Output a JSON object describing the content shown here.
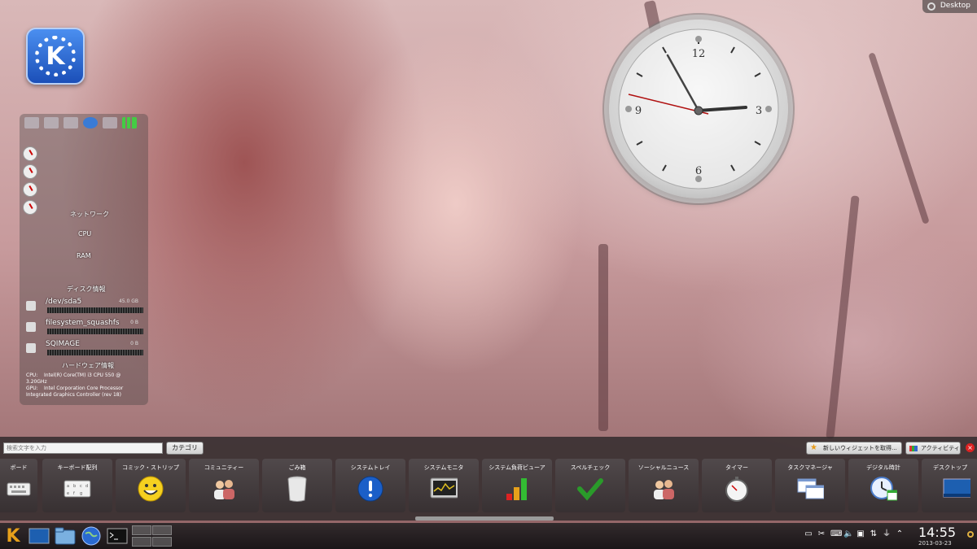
{
  "desktop": {
    "label": "Desktop"
  },
  "system_monitor": {
    "network_label": "ネットワーク",
    "cpu_label": "CPU",
    "ram_label": "RAM",
    "disk_header": "ディスク情報",
    "disks": [
      {
        "name": "/dev/sda5",
        "value": "45.0 GB"
      },
      {
        "name": "filesystem_squashfs",
        "value": "0 B"
      },
      {
        "name": "SQIMAGE",
        "value": "0 B"
      }
    ],
    "hardware_header": "ハードウェア情報",
    "cpu_key": "CPU:",
    "cpu_value": "Intel(R) Core(TM) i3 CPU 550 @ 3.20GHz",
    "gpu_key": "GPU:",
    "gpu_value": "Intel Corporation Core Processor Integrated Graphics Controller (rev 18)"
  },
  "clock_widget": {
    "numerals": [
      "12",
      "3",
      "6",
      "9"
    ]
  },
  "widget_explorer": {
    "search_placeholder": "検索文字を入力",
    "category_label": "カテゴリ",
    "get_widgets_label": "新しいウィジェットを取得...",
    "activities_label": "アクティビティ",
    "widgets": [
      {
        "name": "ボード",
        "icon": "keyboard-icon"
      },
      {
        "name": "キーボード配列",
        "icon": "keyboard-layout-icon"
      },
      {
        "name": "コミック・ストリップ",
        "icon": "smiley-icon"
      },
      {
        "name": "コミュニティー",
        "icon": "community-icon"
      },
      {
        "name": "ごみ箱",
        "icon": "trash-icon"
      },
      {
        "name": "システムトレイ",
        "icon": "info-icon"
      },
      {
        "name": "システムモニタ",
        "icon": "monitor-icon"
      },
      {
        "name": "システム負荷ビューア",
        "icon": "load-bars-icon"
      },
      {
        "name": "スペルチェック",
        "icon": "check-icon"
      },
      {
        "name": "ソーシャルニュース",
        "icon": "social-icon"
      },
      {
        "name": "タイマー",
        "icon": "stopwatch-icon"
      },
      {
        "name": "タスクマネージャ",
        "icon": "windows-icon"
      },
      {
        "name": "デジタル時計",
        "icon": "digital-clock-icon"
      },
      {
        "name": "デスクトップ",
        "icon": "desktop-icon"
      }
    ]
  },
  "taskbar": {
    "time": "14:55",
    "date": "2013-03-23"
  },
  "colors": {
    "panel": "#2d282a",
    "clock_second_hand": "#b01010"
  }
}
